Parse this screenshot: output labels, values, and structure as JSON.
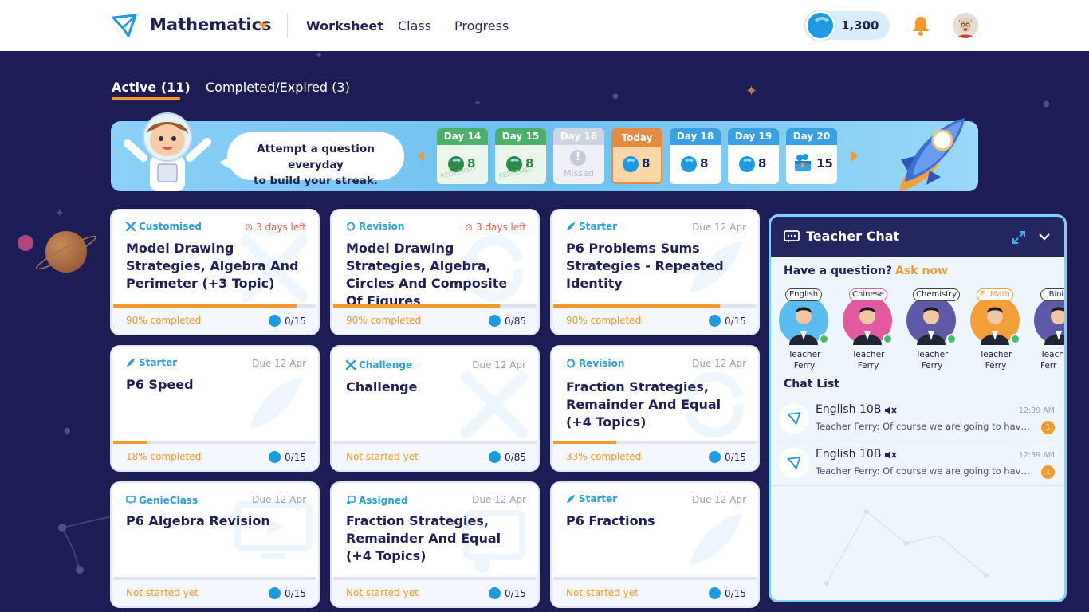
{
  "header": {
    "subject": "Mathematics",
    "nav": [
      {
        "label": "Worksheet"
      },
      {
        "label": "Class"
      },
      {
        "label": "Progress"
      }
    ],
    "coins": "1,300"
  },
  "tabs": [
    {
      "label": "Active (11)"
    },
    {
      "label": "Completed/Expired (3)"
    }
  ],
  "streak": {
    "message_line1": "Attempt a question everyday",
    "message_line2": "to build your streak.",
    "days": [
      {
        "label": "Day 14",
        "value": "8",
        "stamp": "REDEEMED"
      },
      {
        "label": "Day 15",
        "value": "8",
        "stamp": "REDEEMED"
      },
      {
        "label": "Day 16",
        "missed": "Missed"
      },
      {
        "label": "Today",
        "value": "8"
      },
      {
        "label": "Day 18",
        "value": "8"
      },
      {
        "label": "Day 19",
        "value": "8"
      },
      {
        "label": "Day 20",
        "value": "15"
      }
    ]
  },
  "worksheets": [
    {
      "tag": "Customised",
      "due": "3 days left",
      "title": "Model Drawing Strategies, Algebra And Perimeter (+3 Topic)",
      "status": "90% completed",
      "count": "0/15",
      "progress": 0.9
    },
    {
      "tag": "Revision",
      "due": "3 days left",
      "title": "Model Drawing Strategies, Algebra, Circles And Composite Of Figures",
      "status": "90% completed",
      "count": "0/85",
      "progress": 0.82
    },
    {
      "tag": "Starter",
      "due": "Due 12 Apr",
      "title": "P6 Problems Sums Strategies - Repeated Identity",
      "status": "90% completed",
      "count": "0/15",
      "progress": 0.82
    },
    {
      "tag": "Starter",
      "due": "Due 12 Apr",
      "title": "P6 Speed",
      "status": "18% completed",
      "count": "0/15",
      "progress": 0.17
    },
    {
      "tag": "Challenge",
      "due": "Due 12 Apr",
      "title": "Challenge",
      "status": "Not started yet",
      "count": "0/85",
      "progress": 0
    },
    {
      "tag": "Revision",
      "due": "Due 12 Apr",
      "title": "Fraction Strategies, Remainder And Equal (+4 Topics)",
      "status": "33% completed",
      "count": "0/15",
      "progress": 0.31
    },
    {
      "tag": "GenieClass",
      "due": "Due 12 Apr",
      "title": "P6 Algebra Revision",
      "status": "Not started yet",
      "count": "0/15",
      "progress": 0
    },
    {
      "tag": "Assigned",
      "due": "Due 12 Apr",
      "title": "Fraction Strategies, Remainder And Equal (+4 Topics)",
      "status": "Not started yet",
      "count": "0/15",
      "progress": 0
    },
    {
      "tag": "Starter",
      "due": "Due 12 Apr",
      "title": "P6 Fractions",
      "status": "Not started yet",
      "count": "0/15",
      "progress": 0
    }
  ],
  "chat": {
    "title": "Teacher Chat",
    "question": "Have a question?",
    "ask": "Ask now",
    "teachers": [
      {
        "subject": "English",
        "name1": "Teacher",
        "name2": "Ferry",
        "color": "#5bbcf0"
      },
      {
        "subject": "Chinese",
        "name1": "Teacher",
        "name2": "Ferry",
        "color": "#e25aa0"
      },
      {
        "subject": "Chemistry",
        "name1": "Teacher",
        "name2": "Ferry",
        "color": "#5d5aa8"
      },
      {
        "subject": "E. Math",
        "name1": "Teacher",
        "name2": "Ferry",
        "color": "#f3a03a"
      },
      {
        "subject": "Biolo",
        "name1": "Teach",
        "name2": "Ferr",
        "color": "#5d5aa8"
      }
    ],
    "list_title": "Chat List",
    "items": [
      {
        "name": "English 10B",
        "time": "12:39 AM",
        "message": "Teacher Ferry: Of course we are going to have...",
        "badge": "1"
      },
      {
        "name": "English 10B",
        "time": "12:39 AM",
        "message": "Teacher Ferry: Of course we are going to have...",
        "badge": "1"
      }
    ]
  },
  "colors": {
    "background": "#1c1d55",
    "accent": "#f39a2b",
    "brand_blue": "#1e9be0",
    "done_green": "#4caf6a",
    "urgent_red": "#ef5b4f"
  }
}
